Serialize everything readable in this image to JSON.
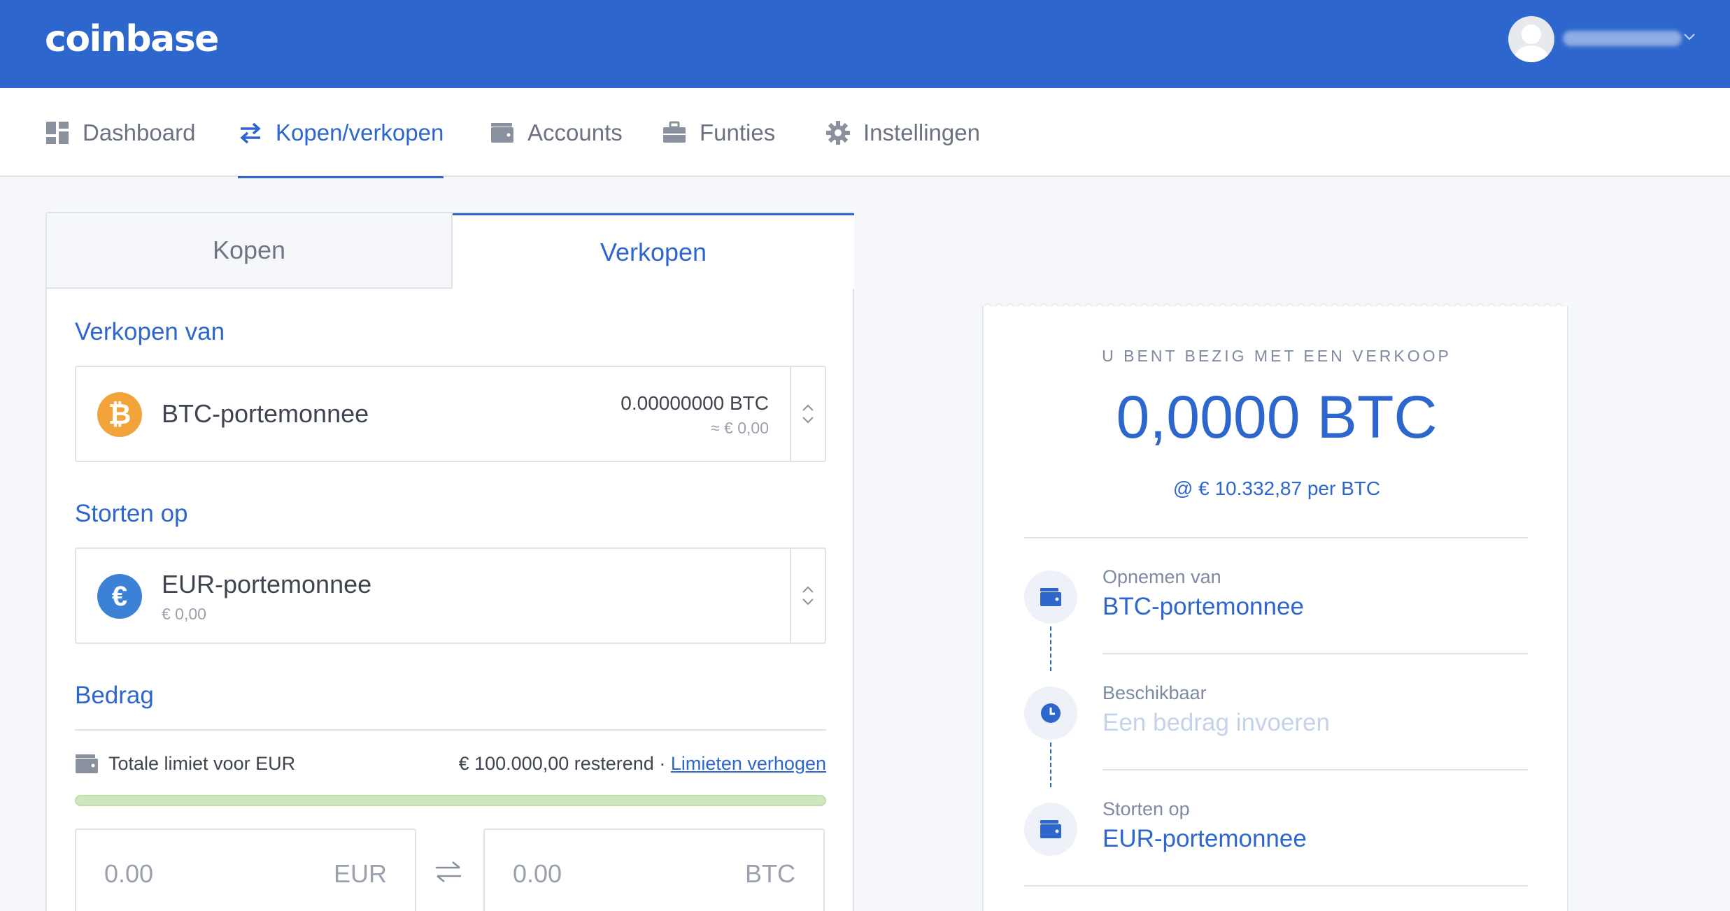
{
  "header": {
    "logo": "coinbase",
    "user_name": "",
    "colors": {
      "brand": "#2d66cc"
    }
  },
  "nav": {
    "items": [
      {
        "label": "Dashboard",
        "icon": "dashboard-icon"
      },
      {
        "label": "Kopen/verkopen",
        "icon": "swap-icon",
        "active": true
      },
      {
        "label": "Accounts",
        "icon": "wallet-icon"
      },
      {
        "label": "Funties",
        "icon": "briefcase-icon"
      },
      {
        "label": "Instellingen",
        "icon": "gear-icon"
      }
    ]
  },
  "trade": {
    "tabs": {
      "buy": "Kopen",
      "sell": "Verkopen"
    },
    "sell_from": {
      "label": "Verkopen van",
      "wallet": "BTC-portemonnee",
      "coin_symbol": "₿",
      "balance": "0.00000000 BTC",
      "balance_fiat": "≈ € 0,00"
    },
    "deposit_to": {
      "label": "Storten op",
      "wallet": "EUR-portemonnee",
      "coin_symbol": "€",
      "balance": "€ 0,00"
    },
    "amount": {
      "label": "Bedrag",
      "limit_label": "Totale limiet voor EUR",
      "limit_remaining": "€ 100.000,00 resterend",
      "separator": "·",
      "limit_link": "Limieten verhogen",
      "limit_used_fraction": 0.0,
      "fiat_value": "0.00",
      "fiat_currency": "EUR",
      "crypto_value": "0.00",
      "crypto_currency": "BTC"
    }
  },
  "summary": {
    "caption": "U BENT BEZIG MET EEN VERKOOP",
    "amount": "0,0000 BTC",
    "rate": "@ € 10.332,87 per BTC",
    "steps": [
      {
        "label": "Opnemen van",
        "value": "BTC-portemonnee",
        "icon": "wallet-icon"
      },
      {
        "label": "Beschikbaar",
        "value": "Een bedrag invoeren",
        "icon": "clock-icon",
        "placeholder": true
      },
      {
        "label": "Storten op",
        "value": "EUR-portemonnee",
        "icon": "wallet-icon"
      }
    ]
  }
}
